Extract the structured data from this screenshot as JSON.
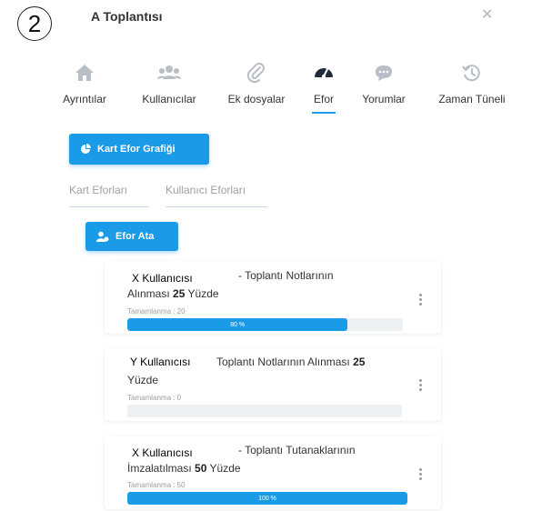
{
  "step_number": "2",
  "header": {
    "title": "A Toplantısı"
  },
  "tabs": [
    {
      "label": "Ayrıntılar",
      "icon": "home-icon"
    },
    {
      "label": "Kullanıcılar",
      "icon": "users-icon"
    },
    {
      "label": "Ek dosyalar",
      "icon": "paperclip-icon"
    },
    {
      "label": "Efor",
      "icon": "gauge-icon",
      "active": true
    },
    {
      "label": "Yorumlar",
      "icon": "comment-icon"
    },
    {
      "label": "Zaman Tüneli",
      "icon": "history-icon"
    }
  ],
  "chart_button": {
    "label": "Kart Efor Grafiği"
  },
  "subtabs": [
    {
      "label": "Kart Eforları"
    },
    {
      "label": "Kullanıcı Eforları"
    }
  ],
  "assign_button": {
    "label": "Efor Ata"
  },
  "colors": {
    "accent": "#1a9be8",
    "track": "#eef1f4"
  },
  "efforts": [
    {
      "user": "X Kullanıcısı",
      "line1": "- Toplantı Notlarının",
      "line2_pre": "Alınması",
      "percent_text": "25",
      "line2_post": "Yüzde",
      "completion_label": "Tamamlanma : 20",
      "progress": 0.8,
      "progress_label": "80 %"
    },
    {
      "user": "Y Kullanıcısı",
      "line1_pre": "Toplantı Notlarının Alınması",
      "percent_text": "25",
      "line2": "Yüzde",
      "completion_label": "Tamamlanma : 0",
      "progress": 0,
      "progress_label": ""
    },
    {
      "user": "X Kullanıcısı",
      "line1": "- Toplantı Tutanaklarının",
      "line2_pre": "İmzalatılması",
      "percent_text": "50",
      "line2_post": "Yüzde",
      "completion_label": "Tamamlanma : 50",
      "progress": 1.0,
      "progress_label": "100 %"
    }
  ]
}
